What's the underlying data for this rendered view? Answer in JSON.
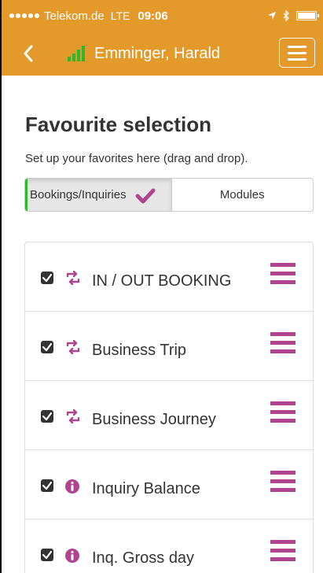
{
  "status_bar": {
    "carrier": "Telekom.de",
    "network": "LTE",
    "time": "09:06"
  },
  "header": {
    "title": "Emminger, Harald"
  },
  "page": {
    "title": "Favourite selection",
    "subtitle": "Set up your favorites here (drag and drop)."
  },
  "tabs": [
    {
      "label": "Bookings/Inquiries",
      "active": true
    },
    {
      "label": "Modules",
      "active": false
    }
  ],
  "list": {
    "items": [
      {
        "label": "IN / OUT BOOKING",
        "icon": "retweet-icon",
        "checked": true
      },
      {
        "label": "Business Trip",
        "icon": "retweet-icon",
        "checked": true
      },
      {
        "label": "Business Journey",
        "icon": "retweet-icon",
        "checked": true
      },
      {
        "label": "Inquiry Balance",
        "icon": "info-circle-icon",
        "checked": true
      },
      {
        "label": "Inq. Gross day",
        "icon": "info-circle-icon",
        "checked": true
      }
    ]
  },
  "colors": {
    "header_bg": "#e39a2a",
    "accent": "#b0458f",
    "signal_green": "#2eb82e"
  }
}
